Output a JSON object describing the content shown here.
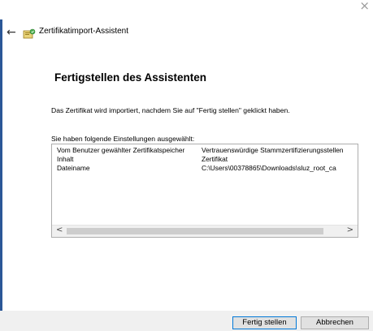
{
  "window": {
    "title": "Zertifikatimport-Assistent",
    "close_symbol": "×",
    "back_symbol": "←"
  },
  "page": {
    "heading": "Fertigstellen des Assistenten",
    "description": "Das Zertifikat wird importiert, nachdem Sie auf \"Fertig stellen\" geklickt haben.",
    "list_label": "Sie haben folgende Einstellungen ausgewählt:"
  },
  "settings": {
    "rows": [
      {
        "key": "Vom Benutzer gewählter Zertifikatspeicher",
        "value": "Vertrauenswürdige Stammzertifizierungsstellen"
      },
      {
        "key": "Inhalt",
        "value": "Zertifikat"
      },
      {
        "key": "Dateiname",
        "value": "C:\\Users\\00378865\\Downloads\\sluz_root_ca"
      }
    ],
    "scroll_left": "<",
    "scroll_right": ">"
  },
  "buttons": {
    "finish": "Fertig stellen",
    "cancel": "Abbrechen"
  },
  "colors": {
    "accent": "#0078d7",
    "button_bg": "#e1e1e1",
    "footer_bg": "#f0f0f0",
    "border": "#adadad"
  },
  "icons": {
    "wizard": "certificate-wizard-icon",
    "back": "back-arrow-icon",
    "close": "close-icon"
  }
}
